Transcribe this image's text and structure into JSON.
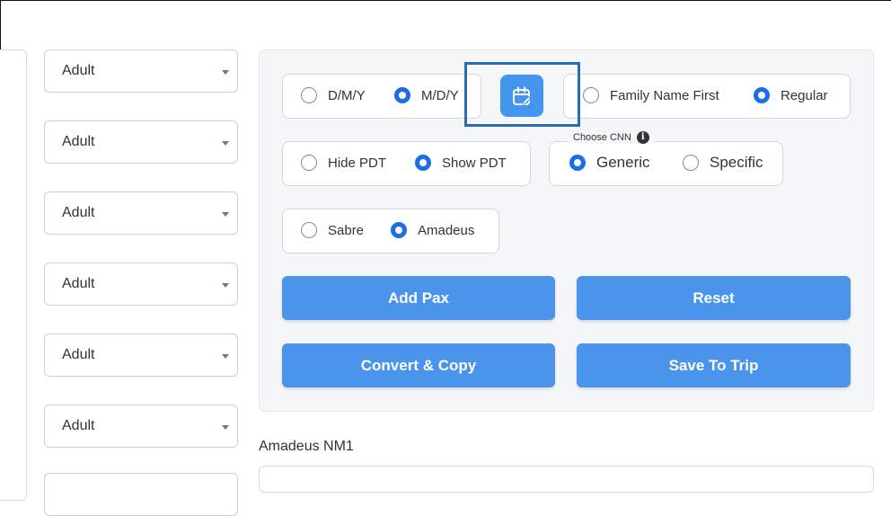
{
  "passengers": {
    "types": [
      "Adult",
      "Adult",
      "Adult",
      "Adult",
      "Adult",
      "Adult"
    ]
  },
  "options": {
    "date_format": {
      "dmy": "D/M/Y",
      "mdy": "M/D/Y",
      "selected": "M/D/Y"
    },
    "name_order": {
      "family_first": "Family Name First",
      "regular": "Regular",
      "selected": "Regular"
    },
    "pdt": {
      "hide": "Hide PDT",
      "show": "Show PDT",
      "selected": "Show PDT"
    },
    "cnn": {
      "label": "Choose CNN",
      "generic": "Generic",
      "specific": "Specific",
      "selected": "Generic"
    },
    "gds": {
      "sabre": "Sabre",
      "amadeus": "Amadeus",
      "selected": "Amadeus"
    }
  },
  "icons": {
    "calendar": "calendar-edit-icon",
    "info": "info-icon",
    "dropdown": "caret-down-icon"
  },
  "buttons": {
    "add_pax": "Add Pax",
    "reset": "Reset",
    "convert_copy": "Convert & Copy",
    "save_to_trip": "Save To Trip"
  },
  "output": {
    "label": "Amadeus NM1"
  },
  "colors": {
    "accent": "#1a6fe8",
    "button": "#4a95eb",
    "highlight": "#2a6bb4"
  }
}
